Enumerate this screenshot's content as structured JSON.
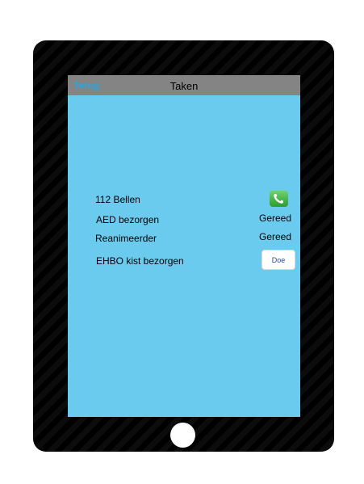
{
  "navbar": {
    "back_label": "Terug",
    "title": "Taken"
  },
  "tasks": [
    {
      "label": "112 Bellen",
      "action": "call",
      "icon": "phone-icon"
    },
    {
      "label": "AED bezorgen",
      "status": "Gereed"
    },
    {
      "label": "Reanimeerder",
      "status": "Gereed"
    },
    {
      "label": "EHBO kist bezorgen",
      "button_label": "Doe"
    }
  ],
  "colors": {
    "screen_background": "#6bcbee",
    "navbar_background": "#848484",
    "back_link": "#2aa6de",
    "call_button": "#3cb43c"
  }
}
